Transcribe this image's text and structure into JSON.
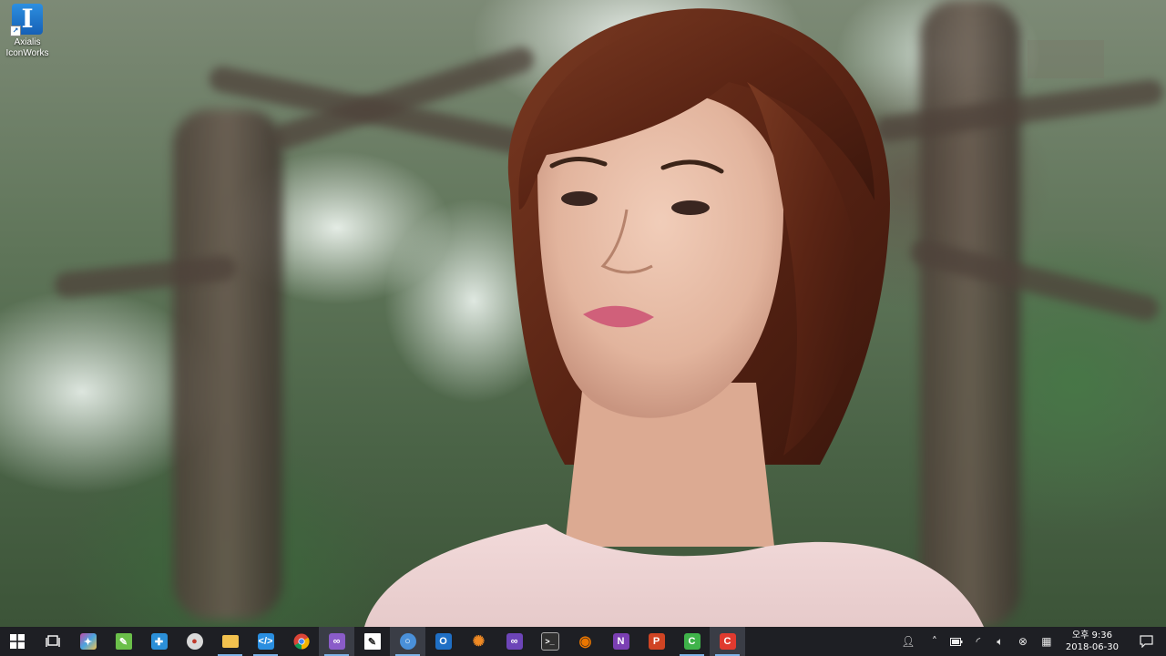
{
  "desktop": {
    "icons": [
      {
        "name": "axialis-iconworks",
        "label": "Axialis\nIconWorks",
        "glyph": "I"
      }
    ]
  },
  "taskbar": {
    "start_icon": "windows-logo-icon",
    "task_view_icon": "task-view-icon",
    "pinned_apps": [
      {
        "name": "color-picker",
        "icon": "palette-app-icon",
        "color": "#c04ca8",
        "running": false
      },
      {
        "name": "notepad-plus",
        "icon": "notepad-icon",
        "color": "#6bbf4a",
        "running": false
      },
      {
        "name": "blue-app",
        "icon": "puzzle-icon",
        "color": "#2b8fd8",
        "running": false
      },
      {
        "name": "paint-tool",
        "icon": "paint-palette-icon",
        "color": "#d9d9d9",
        "running": false
      },
      {
        "name": "file-explorer",
        "icon": "folder-icon",
        "color": "#f2c14e",
        "running": true
      },
      {
        "name": "vs-code",
        "icon": "vscode-icon",
        "color": "#2a8ee0",
        "running": true
      },
      {
        "name": "chrome",
        "icon": "chrome-icon",
        "color": "#4caf50",
        "running": false
      },
      {
        "name": "visual-studio",
        "icon": "visual-studio-icon",
        "color": "#8a5cc9",
        "running": true
      },
      {
        "name": "sticky-app",
        "icon": "note-pen-icon",
        "color": "#ffffff",
        "running": false
      },
      {
        "name": "search-app",
        "icon": "magnifier-app-icon",
        "color": "#4a90d9",
        "running": true
      },
      {
        "name": "outlook",
        "icon": "outlook-icon",
        "color": "#1f6fc5",
        "running": false
      },
      {
        "name": "orange-app",
        "icon": "sun-gear-icon",
        "color": "#f08a24",
        "running": false
      },
      {
        "name": "visual-studio-2",
        "icon": "visual-studio-icon",
        "color": "#6d45b8",
        "running": false
      },
      {
        "name": "terminal",
        "icon": "terminal-icon",
        "color": "#303030",
        "running": false
      },
      {
        "name": "blender",
        "icon": "blender-icon",
        "color": "#ea7600",
        "running": false
      },
      {
        "name": "onenote",
        "icon": "onenote-icon",
        "color": "#7b3fb3",
        "running": false
      },
      {
        "name": "powerpoint",
        "icon": "powerpoint-icon",
        "color": "#d04423",
        "running": false
      },
      {
        "name": "camtasia-green",
        "icon": "c-green-icon",
        "color": "#3fb34a",
        "running": true
      },
      {
        "name": "camtasia-red",
        "icon": "c-red-icon",
        "color": "#e03a2f",
        "running": true
      }
    ],
    "tray": {
      "people_icon": "people-icon",
      "overflow_icon": "chevron-up-icon",
      "battery_icon": "battery-icon",
      "network_icon": "wifi-icon",
      "volume_icon": "speaker-icon",
      "status_icon": "close-circle-icon",
      "ime_icon": "ime-icon",
      "clock": {
        "time": "오후 9:36",
        "date": "2018-06-30"
      },
      "notification_icon": "notification-icon"
    }
  }
}
